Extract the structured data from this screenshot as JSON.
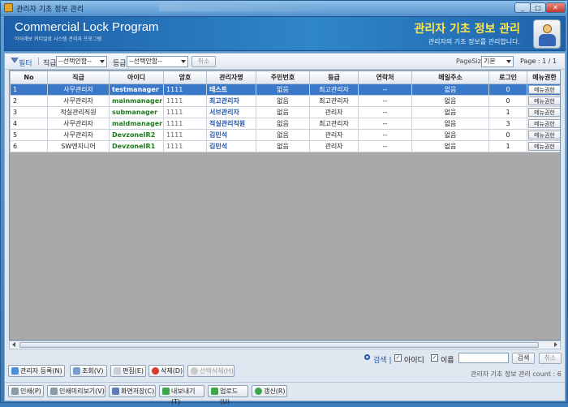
{
  "window": {
    "title": "관리자 기초 정보 관리",
    "min_glyph": "_",
    "max_glyph": "□",
    "close_glyph": "✕"
  },
  "banner": {
    "program_title": "Commercial Lock Program",
    "program_subtitle": "아이래보 커티얼료 시스템 관리자 프로그램",
    "heading": "관리자 기초 정보 관리",
    "description": "관리자의 기초 정보를 관리합니다.",
    "icon": "admin-person-icon"
  },
  "filter": {
    "label": "필터",
    "separator": "|",
    "position_label": "직급",
    "position_select": "--선택안함--",
    "grade_label": "등급",
    "grade_select": "--선택안함--",
    "cancel_label": "취소",
    "pagesize_label": "PageSize",
    "pagesize_select": "기본",
    "page_label": "Page :",
    "page_value": "1 / 1"
  },
  "grid": {
    "columns": [
      "No",
      "직급",
      "아이디",
      "암호",
      "관리자명",
      "주민번호",
      "등급",
      "연락처",
      "메일주소",
      "로그인",
      "메뉴권한"
    ],
    "rows": [
      {
        "no": "1",
        "position": "사무관리자",
        "id": "testmanager",
        "password": "1111",
        "name": "테스트",
        "ssn": "없음",
        "grade": "최고관리자",
        "contact": "--",
        "email": "없음",
        "login": "0",
        "menu": "메뉴권한"
      },
      {
        "no": "2",
        "position": "사무관리자",
        "id": "mainmanager",
        "password": "1111",
        "name": "최고관리자",
        "ssn": "없음",
        "grade": "최고관리자",
        "contact": "--",
        "email": "없음",
        "login": "0",
        "menu": "메뉴권한"
      },
      {
        "no": "3",
        "position": "적실관리직원",
        "id": "submanager",
        "password": "1111",
        "name": "서브관리자",
        "ssn": "없음",
        "grade": "관리자",
        "contact": "--",
        "email": "없음",
        "login": "1",
        "menu": "메뉴권한"
      },
      {
        "no": "4",
        "position": "사무관리자",
        "id": "maidmanager",
        "password": "1111",
        "name": "적실관리직원",
        "ssn": "없음",
        "grade": "최고관리자",
        "contact": "--",
        "email": "없음",
        "login": "3",
        "menu": "메뉴권한"
      },
      {
        "no": "5",
        "position": "사무관리자",
        "id": "DevzoneIR2",
        "password": "1111",
        "name": "김민석",
        "ssn": "없음",
        "grade": "관리자",
        "contact": "--",
        "email": "없음",
        "login": "0",
        "menu": "메뉴권한"
      },
      {
        "no": "6",
        "position": "SW엔지니어",
        "id": "DevzoneIR1",
        "password": "1111",
        "name": "김민석",
        "ssn": "없음",
        "grade": "관리자",
        "contact": "--",
        "email": "없음",
        "login": "1",
        "menu": "메뉴권한"
      }
    ]
  },
  "search": {
    "label": "검색",
    "separator": "|",
    "check_id_label": "아이디",
    "check_name_label": "이름",
    "check_mark": "✓",
    "search_button": "검색",
    "cancel_button": "취소"
  },
  "actions_row1": {
    "add": "관리자 등록(N)",
    "view": "조회(V)",
    "edit": "편집(E)",
    "delete": "삭제(D)",
    "delete_selected": "선택삭제(H)"
  },
  "actions_row2": {
    "print": "인쇄(P)",
    "print_preview": "인쇄미리보기(V)",
    "save_screen": "화면저장(C)",
    "export": "내보내기(T)",
    "upload": "업로드(U)",
    "refresh": "갱신(R)"
  },
  "status": {
    "count_text": "관리자 기초 정보 관리 count : 6"
  },
  "colors": {
    "accent": "#2f86c8",
    "heading_yellow": "#ffe94a",
    "selected_row": "#3a78c9",
    "id_green": "#1a7d1a",
    "name_blue": "#2355a8"
  }
}
